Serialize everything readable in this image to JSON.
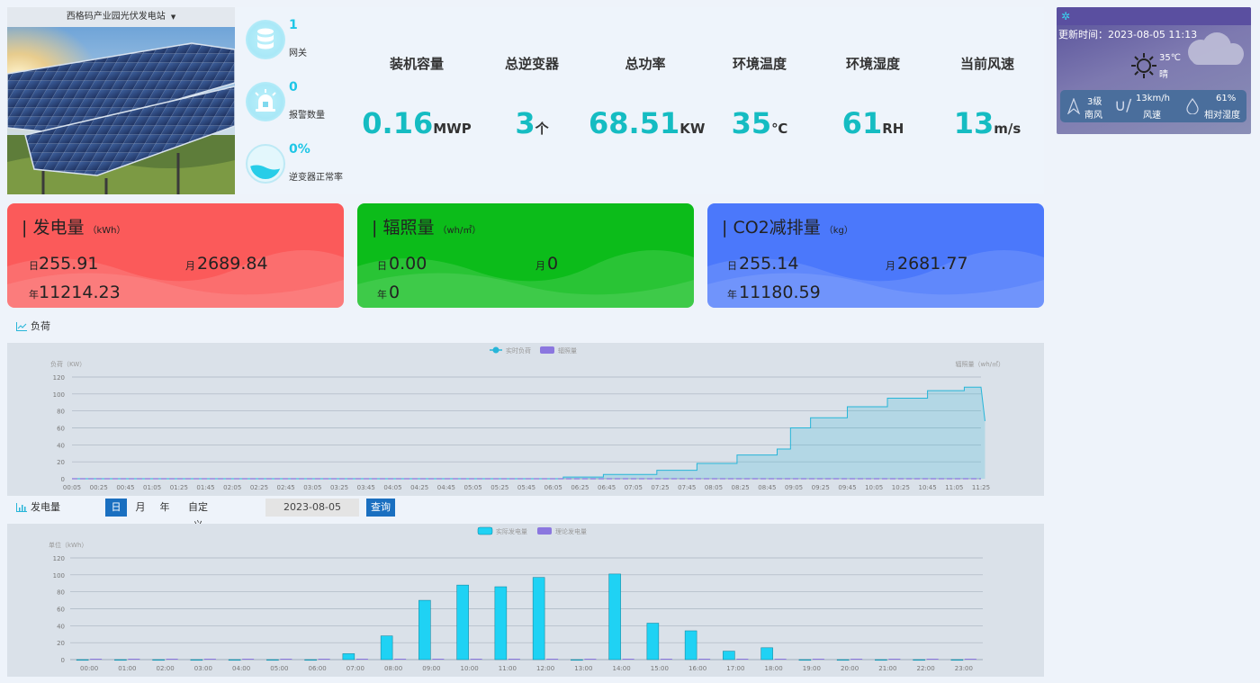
{
  "station": {
    "name": "西格码产业园光伏发电站"
  },
  "stats": [
    {
      "value": "1",
      "label": "网关"
    },
    {
      "value": "0",
      "label": "报警数量"
    },
    {
      "value": "0%",
      "label": "逆变器正常率"
    }
  ],
  "kpis": [
    {
      "title": "装机容量",
      "value": "0.16",
      "unit": "MWP"
    },
    {
      "title": "总逆变器",
      "value": "3",
      "unit": "个"
    },
    {
      "title": "总功率",
      "value": "68.51",
      "unit": "KW"
    },
    {
      "title": "环境温度",
      "value": "35",
      "unit": "℃"
    },
    {
      "title": "环境湿度",
      "value": "61",
      "unit": "RH"
    },
    {
      "title": "当前风速",
      "value": "13",
      "unit": "m/s"
    }
  ],
  "weather": {
    "updated_label": "更新时间：",
    "updated_time": "2023-08-05 11:13",
    "temp": "35℃",
    "condition": "晴",
    "wind_level": "3级",
    "wind_dir": "南风",
    "wind_speed": "13km/h",
    "wind_speed_label": "风速",
    "humidity": "61%",
    "humidity_label": "相对湿度"
  },
  "cards": [
    {
      "title": "发电量",
      "unit": "（kWh）",
      "day_label": "日",
      "day": "255.91",
      "month_label": "月",
      "month": "2689.84",
      "year_label": "年",
      "year": "11214.23",
      "color": "#fb5a5a"
    },
    {
      "title": "辐照量",
      "unit": "（wh/㎡）",
      "day_label": "日",
      "day": "0.00",
      "month_label": "月",
      "month": "0",
      "year_label": "年",
      "year": "0",
      "color": "#0cbc1a"
    },
    {
      "title": "CO2减排量",
      "unit": "（kg）",
      "day_label": "日",
      "day": "255.14",
      "month_label": "月",
      "month": "2681.77",
      "year_label": "年",
      "year": "11180.59",
      "color": "#4b78fb"
    }
  ],
  "load_section": {
    "title": "负荷"
  },
  "gen_section": {
    "title": "发电量",
    "periods": [
      "日",
      "月",
      "年",
      "自定义"
    ],
    "active_period": "日",
    "date": "2023-08-05",
    "query_label": "查询"
  },
  "chart_data": [
    {
      "type": "area",
      "series": [
        {
          "name": "实时负荷",
          "color": "#27b5d8",
          "x": [
            "00:05",
            "06:00",
            "06:25",
            "07:00",
            "07:45",
            "08:00",
            "08:45",
            "09:00",
            "09:05",
            "09:30",
            "10:00",
            "10:30",
            "11:00",
            "11:25",
            "11:28"
          ],
          "values": [
            0,
            0,
            2,
            5,
            10,
            18,
            28,
            35,
            60,
            72,
            85,
            95,
            104,
            108,
            68
          ]
        },
        {
          "name": "辐照量",
          "color": "#8b77df",
          "values": [
            0
          ]
        }
      ],
      "ylabel": "负荷（KW）",
      "y2label": "辐照量（wh/㎡）",
      "ylim": [
        0,
        120
      ],
      "yticks": [
        0,
        20,
        40,
        60,
        80,
        100,
        120
      ],
      "xticks": [
        "00:05",
        "00:25",
        "00:45",
        "01:05",
        "01:25",
        "01:45",
        "02:05",
        "02:25",
        "02:45",
        "03:05",
        "03:25",
        "03:45",
        "04:05",
        "04:25",
        "04:45",
        "05:05",
        "05:25",
        "05:45",
        "06:05",
        "06:25",
        "06:45",
        "07:05",
        "07:25",
        "07:45",
        "08:05",
        "08:25",
        "08:45",
        "09:05",
        "09:25",
        "09:45",
        "10:05",
        "10:25",
        "10:45",
        "11:05",
        "11:25"
      ],
      "grid": true,
      "legend": "top-center"
    },
    {
      "type": "bar",
      "categories": [
        "00:00",
        "01:00",
        "02:00",
        "03:00",
        "04:00",
        "05:00",
        "06:00",
        "07:00",
        "08:00",
        "09:00",
        "10:00",
        "11:00",
        "12:00",
        "13:00",
        "14:00",
        "15:00",
        "16:00",
        "17:00",
        "18:00",
        "19:00",
        "20:00",
        "21:00",
        "22:00",
        "23:00"
      ],
      "series": [
        {
          "name": "实际发电量",
          "color": "#1fd2f4",
          "values": [
            0,
            0,
            0,
            0,
            0,
            0,
            0,
            7,
            28,
            70,
            88,
            86,
            97,
            0,
            101,
            43,
            34,
            10,
            14,
            0,
            0,
            0,
            0,
            0
          ]
        },
        {
          "name": "理论发电量",
          "color": "#8b77df",
          "values": [
            0,
            0,
            0,
            0,
            0,
            0,
            0,
            0,
            0,
            0,
            0,
            0,
            0,
            0,
            0,
            0,
            0,
            0,
            0,
            0,
            0,
            0,
            0,
            0
          ]
        }
      ],
      "ylabel": "单位（kWh）",
      "ylim": [
        0,
        120
      ],
      "yticks": [
        0,
        20,
        40,
        60,
        80,
        100,
        120
      ],
      "grid": true,
      "legend": "top-center"
    }
  ]
}
